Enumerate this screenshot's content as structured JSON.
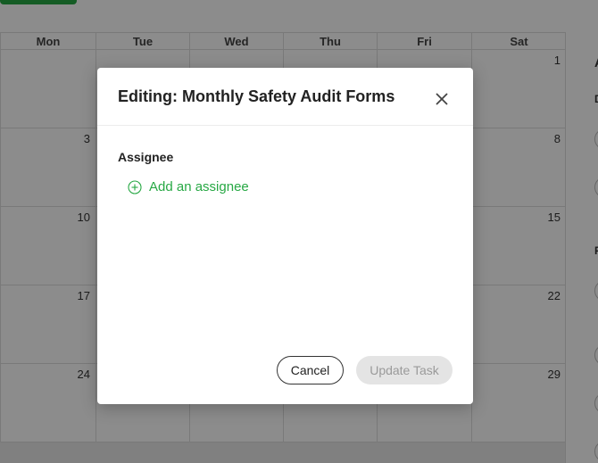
{
  "calendar": {
    "weekdays": [
      "Mon",
      "Tue",
      "Wed",
      "Thu",
      "Fri",
      "Sat"
    ],
    "weeks": [
      [
        "",
        "",
        "",
        "",
        "",
        "1"
      ],
      [
        "3",
        "",
        "",
        "",
        "",
        "8"
      ],
      [
        "10",
        "",
        "",
        "",
        "",
        "15"
      ],
      [
        "17",
        "",
        "",
        "",
        "",
        "22"
      ],
      [
        "24",
        "",
        "",
        "",
        "",
        "29"
      ]
    ]
  },
  "right_panel": {
    "letters": [
      "A",
      "D",
      "F"
    ]
  },
  "modal": {
    "title": "Editing: Monthly Safety Audit Forms",
    "assignee_label": "Assignee",
    "add_assignee": "Add an assignee",
    "cancel_label": "Cancel",
    "update_label": "Update Task"
  },
  "colors": {
    "accent": "#27a844",
    "overlay": "rgba(0,0,0,0.45)"
  },
  "icons": {
    "close": "close-icon",
    "add": "plus-circle-icon"
  }
}
